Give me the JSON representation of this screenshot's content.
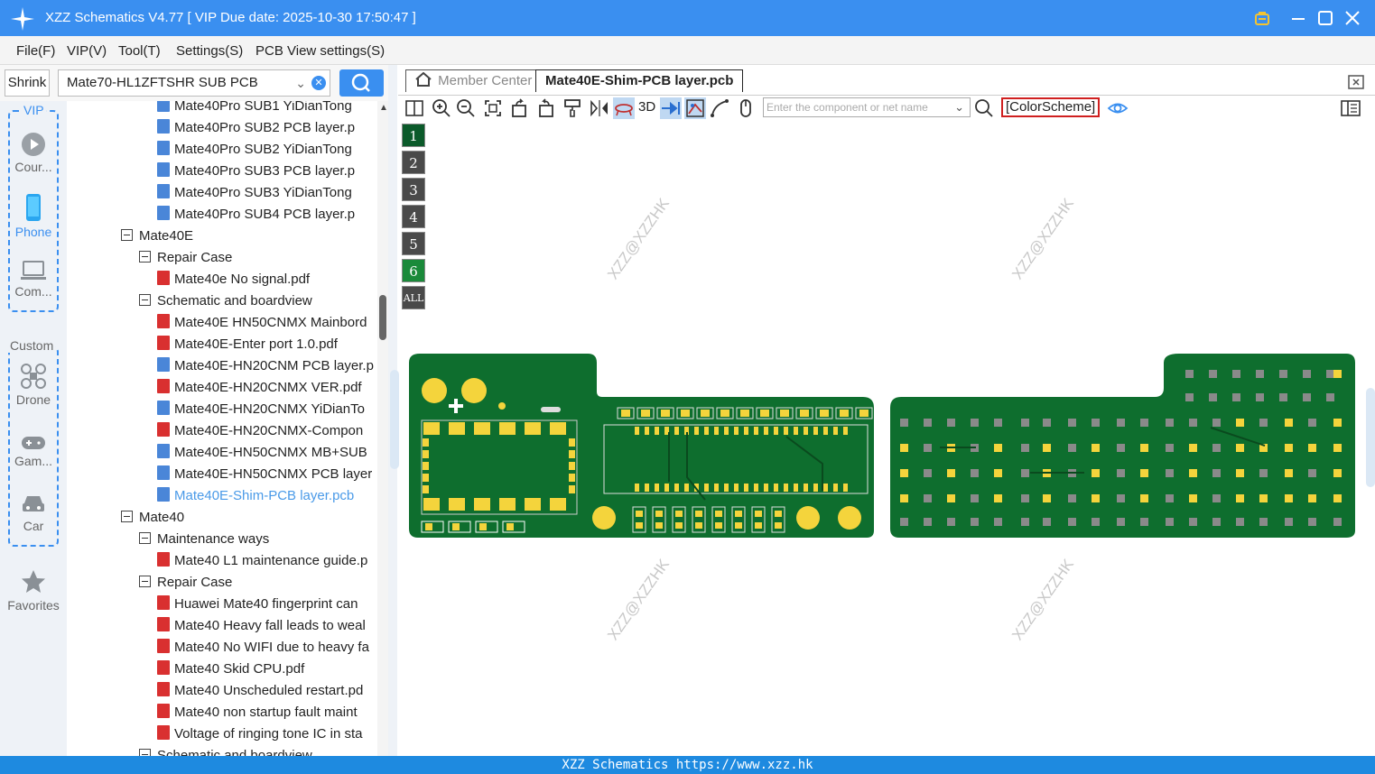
{
  "window": {
    "title": "XZZ Schematics V4.77 [ VIP Due date: 2025-10-30 17:50:47 ]",
    "accent_color": "#3a8ff0"
  },
  "menu": [
    "File(F)",
    "VIP(V)",
    "Tool(T)",
    "Settings(S)",
    "PCB View settings(S)"
  ],
  "search": {
    "shrink_label": "Shrink",
    "selected_board": "Mate70-HL1ZFTSHR SUB PCB"
  },
  "nav": {
    "vip_label": "VIP",
    "vip_items": [
      "Cour...",
      "Phone",
      "Com..."
    ],
    "custom_label": "Custom",
    "custom_items": [
      "Drone",
      "Gam...",
      "Car"
    ],
    "favorites": "Favorites"
  },
  "tree": [
    {
      "indent": 2,
      "kind": "pcb",
      "label": "Mate40Pro SUB1 YiDianTong"
    },
    {
      "indent": 2,
      "kind": "pcb",
      "label": "Mate40Pro SUB2 PCB layer.p"
    },
    {
      "indent": 2,
      "kind": "pcb",
      "label": "Mate40Pro SUB2 YiDianTong"
    },
    {
      "indent": 2,
      "kind": "pcb",
      "label": "Mate40Pro SUB3 PCB layer.p"
    },
    {
      "indent": 2,
      "kind": "pcb",
      "label": "Mate40Pro SUB3 YiDianTong"
    },
    {
      "indent": 2,
      "kind": "pcb",
      "label": "Mate40Pro SUB4 PCB layer.p"
    },
    {
      "indent": 0,
      "kind": "folder",
      "label": "Mate40E"
    },
    {
      "indent": 1,
      "kind": "folder",
      "label": "Repair Case"
    },
    {
      "indent": 2,
      "kind": "pdf",
      "label": "Mate40e No signal.pdf"
    },
    {
      "indent": 1,
      "kind": "folder",
      "label": "Schematic and boardview"
    },
    {
      "indent": 2,
      "kind": "pdf",
      "label": "Mate40E HN50CNMX Mainbord"
    },
    {
      "indent": 2,
      "kind": "pdf",
      "label": "Mate40E-Enter port 1.0.pdf"
    },
    {
      "indent": 2,
      "kind": "pcb",
      "label": "Mate40E-HN20CNM PCB layer.p"
    },
    {
      "indent": 2,
      "kind": "pdf",
      "label": "Mate40E-HN20CNMX VER.pdf"
    },
    {
      "indent": 2,
      "kind": "pcb",
      "label": "Mate40E-HN20CNMX YiDianTo"
    },
    {
      "indent": 2,
      "kind": "pdf",
      "label": "Mate40E-HN20CNMX-Compon"
    },
    {
      "indent": 2,
      "kind": "pcb",
      "label": "Mate40E-HN50CNMX MB+SUB"
    },
    {
      "indent": 2,
      "kind": "pcb",
      "label": "Mate40E-HN50CNMX PCB layer"
    },
    {
      "indent": 2,
      "kind": "pcb",
      "label": "Mate40E-Shim-PCB layer.pcb",
      "selected": true
    },
    {
      "indent": 0,
      "kind": "folder",
      "label": "Mate40"
    },
    {
      "indent": 1,
      "kind": "folder",
      "label": "Maintenance ways"
    },
    {
      "indent": 2,
      "kind": "pdf",
      "label": "Mate40 L1 maintenance guide.p"
    },
    {
      "indent": 1,
      "kind": "folder",
      "label": "Repair Case"
    },
    {
      "indent": 2,
      "kind": "pdf",
      "label": "Huawei Mate40 fingerprint can"
    },
    {
      "indent": 2,
      "kind": "pdf",
      "label": "Mate40 Heavy fall leads to weal"
    },
    {
      "indent": 2,
      "kind": "pdf",
      "label": "Mate40 No WIFI due to heavy fa"
    },
    {
      "indent": 2,
      "kind": "pdf",
      "label": "Mate40 Skid CPU.pdf"
    },
    {
      "indent": 2,
      "kind": "pdf",
      "label": "Mate40 Unscheduled restart.pd"
    },
    {
      "indent": 2,
      "kind": "pdf",
      "label": "Mate40 non startup fault maint"
    },
    {
      "indent": 2,
      "kind": "pdf",
      "label": "Voltage of ringing tone IC in sta"
    },
    {
      "indent": 1,
      "kind": "folder",
      "label": "Schematic and boardview"
    }
  ],
  "tabs": {
    "member_center": "Member Center",
    "active": "Mate40E-Shim-PCB layer.pcb"
  },
  "toolbar": {
    "three_d": "3D",
    "net_placeholder": "Enter the component or net name",
    "color_scheme": "[ColorScheme]"
  },
  "layers": [
    {
      "label": "1",
      "color": "#0b5a2a"
    },
    {
      "label": "2",
      "color": "#4a4a4a"
    },
    {
      "label": "3",
      "color": "#4a4a4a"
    },
    {
      "label": "4",
      "color": "#4a4a4a"
    },
    {
      "label": "5",
      "color": "#4a4a4a"
    },
    {
      "label": "6",
      "color": "#1a8a3a"
    },
    {
      "label": "ALL",
      "color": "#4a4a4a"
    }
  ],
  "watermark": "XZZ@XZZHK",
  "board_colors": {
    "pcb": "#0e6e2e",
    "pad": "#f4d43c",
    "grey_pad": "#8a8a8a"
  },
  "status": "XZZ Schematics https://www.xzz.hk"
}
